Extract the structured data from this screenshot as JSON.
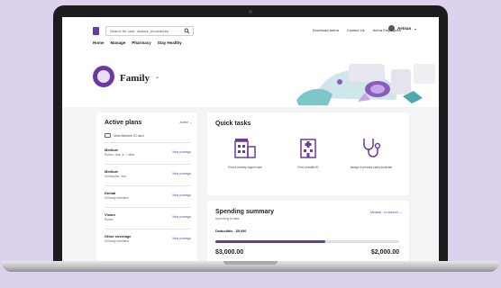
{
  "header": {
    "search": {
      "placeholder": "Search for care, doctors, procedures"
    },
    "links": [
      "Download Aetna",
      "Contact Us",
      "Aetna Employees"
    ],
    "user_name": "Aetnan"
  },
  "nav": [
    "Home",
    "Manage",
    "Pharmacy",
    "Stay Healthy"
  ],
  "hero": {
    "title": "Family"
  },
  "active_plans": {
    "title": "Active plans",
    "filter_label": "Active",
    "view_id_label": "View Member ID card",
    "plans": [
      {
        "name": "Medical",
        "sub": "Robert, Jodi, Jr. + other",
        "link": "View coverage"
      },
      {
        "name": "Medical",
        "sub": "Christopher, Jodi",
        "link": "View coverage"
      },
      {
        "name": "Dental",
        "sub": "All family members",
        "link": "View coverage"
      },
      {
        "name": "Vision",
        "sub": "Robert",
        "link": "View coverage"
      },
      {
        "name": "Other coverage",
        "sub": "All family members",
        "link": "View coverage"
      }
    ]
  },
  "quick_tasks": {
    "title": "Quick tasks",
    "tasks": [
      {
        "label": "Find a nearby urgent care",
        "icon": "urgent-care-building-icon"
      },
      {
        "label": "Find a health ID",
        "icon": "hospital-building-icon"
      },
      {
        "label": "Assign a primary care physician",
        "icon": "stethoscope-icon"
      }
    ]
  },
  "spending_summary": {
    "title": "Spending summary",
    "subtitle": "Spending to date",
    "link": "Medical - in network",
    "deductible_label": "Deductible - $5,000",
    "spent": "$3,000.00",
    "total": "$2,000.00",
    "progress": 0.6
  },
  "colors": {
    "accent": "#6b3aa0",
    "background": "#ddd2ec"
  }
}
